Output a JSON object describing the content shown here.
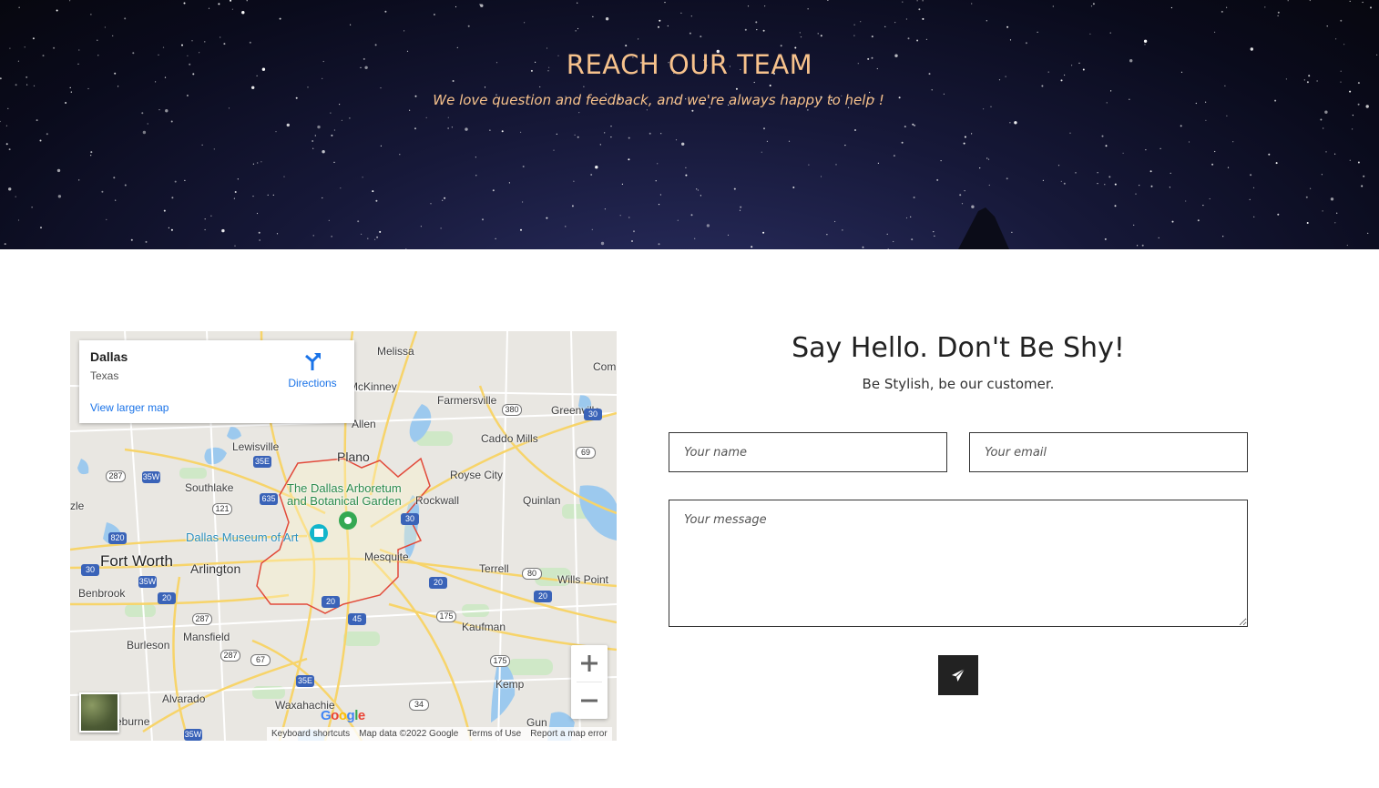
{
  "hero": {
    "title": "REACH OUR TEAM",
    "subtitle": "We love question and feedback, and we're always happy to help !",
    "title_color": "#f7c28c"
  },
  "map": {
    "place_name": "Dallas",
    "place_region": "Texas",
    "directions_label": "Directions",
    "larger_map_link": "View larger map",
    "labels": {
      "melissa": "Melissa",
      "com": "Com",
      "mckinney": "McKinney",
      "farmersville": "Farmersville",
      "greenville": "Greenville",
      "allen": "Allen",
      "caddo_mills": "Caddo Mills",
      "lewisville": "Lewisville",
      "plano": "Plano",
      "royse_city": "Royse City",
      "southlake": "Southlake",
      "arboretum": "The Dallas Arboretum\nand Botanical Garden",
      "rockwall": "Rockwall",
      "quinlan": "Quinlan",
      "zle": "zle",
      "museum": "Dallas Museum of Art",
      "fort_worth": "Fort Worth",
      "arlington": "Arlington",
      "mesquite": "Mesquite",
      "terrell": "Terrell",
      "wills_point": "Wills Point",
      "benbrook": "Benbrook",
      "kaufman": "Kaufman",
      "mansfield": "Mansfield",
      "burleson": "Burleson",
      "kemp": "Kemp",
      "alvarado": "Alvarado",
      "waxahachie": "Waxahachie",
      "eburne": "eburne",
      "gun": "Gun"
    },
    "shields": {
      "s380": "380",
      "i30a": "30",
      "s69": "69",
      "s287a": "287",
      "i35w_a": "35W",
      "i35e_a": "35E",
      "i635": "635",
      "s121": "121",
      "i820": "820",
      "i30b": "30",
      "i35w_b": "35W",
      "i20a": "20",
      "i30c": "30",
      "s80": "80",
      "i20b": "20",
      "i20c": "20",
      "i20d": "20",
      "i45": "45",
      "s175a": "175",
      "s287b": "287",
      "s287c": "287",
      "s67": "67",
      "i35e_b": "35E",
      "s175b": "175",
      "s34": "34",
      "i35w_c": "35W"
    },
    "google_logo": "Google",
    "attribution": [
      "Keyboard shortcuts",
      "Map data ©2022 Google",
      "Terms of Use",
      "Report a map error"
    ]
  },
  "form": {
    "title": "Say Hello. Don't Be Shy!",
    "subtitle": "Be Stylish, be our customer.",
    "name_placeholder": "Your name",
    "email_placeholder": "Your email",
    "message_placeholder": "Your message",
    "accent": "#222222"
  }
}
